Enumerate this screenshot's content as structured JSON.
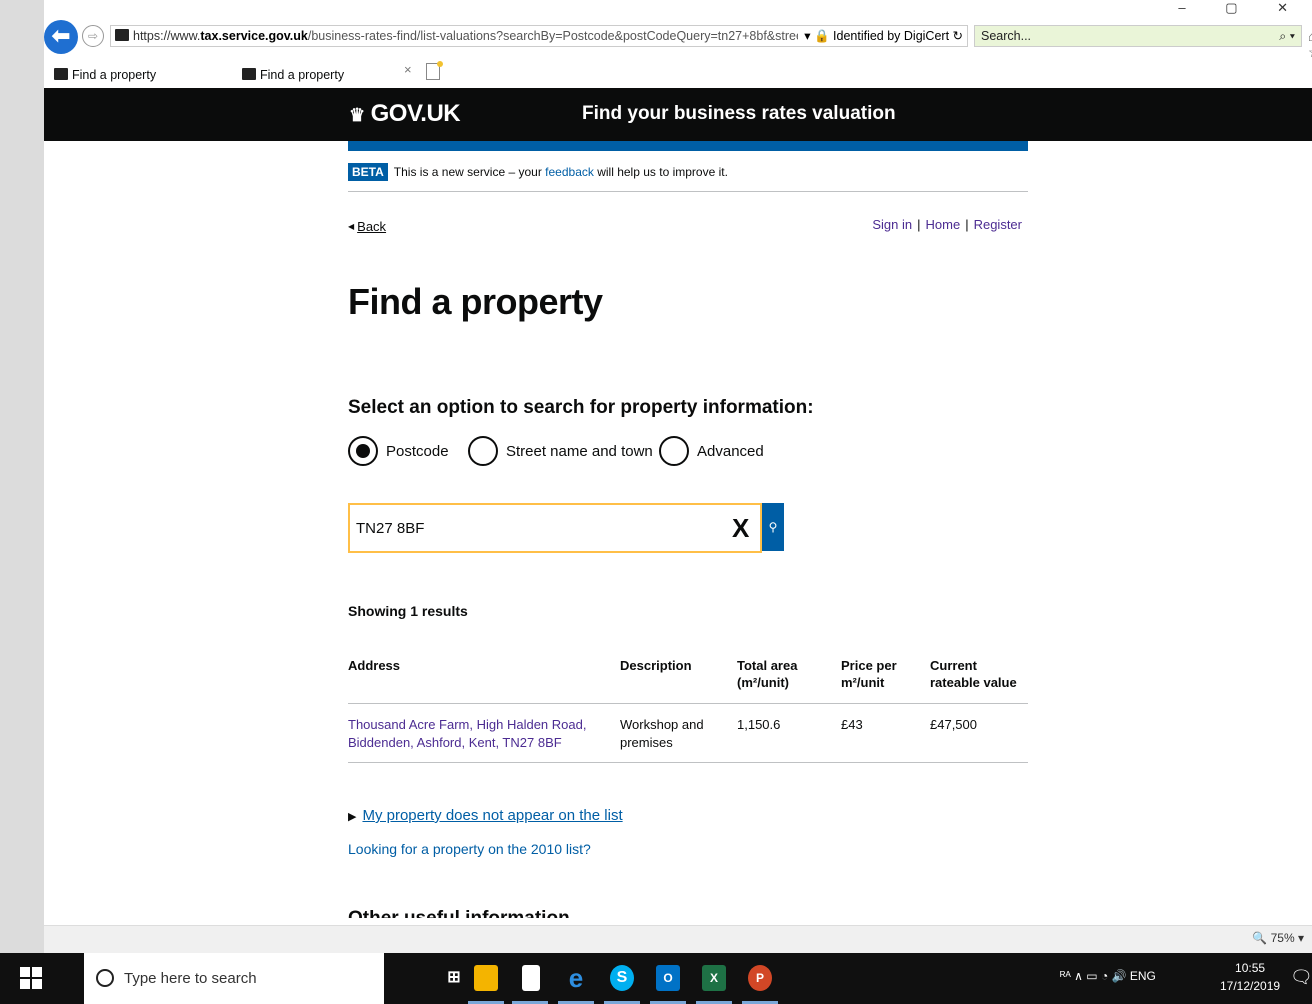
{
  "browser": {
    "back_icon": "back-arrow-icon",
    "url_prefix": "https://www.",
    "url_domain": "tax.service.gov.uk",
    "url_path": "/business-rates-find/list-valuations?searchBy=Postcode&postCodeQuery=tn27+8bf&streetQu",
    "cert": "▾ 🔒 Identified by DigiCert ↻",
    "search_placeholder": "Search...",
    "search_icon": "⌕ ▾",
    "right_icons": "⌂ ☆",
    "window_controls": "– ▢ ✕",
    "tabs": [
      {
        "label": "Find a property"
      },
      {
        "label": "Find a property"
      }
    ],
    "tab_close": "×"
  },
  "header": {
    "logo": "GOV.UK",
    "crown": "♛",
    "service_name": "Find your business rates valuation"
  },
  "beta": {
    "tag": "BETA",
    "text_before": "This is a new service – your ",
    "link": "feedback",
    "text_after": " will help us to improve it."
  },
  "nav": {
    "back": "Back",
    "sign_in": "Sign in",
    "home": "Home",
    "register": "Register",
    "sep": "|"
  },
  "page": {
    "title": "Find a property",
    "select_label": "Select an option to search for property information:",
    "radios": [
      {
        "label": "Postcode",
        "selected": true
      },
      {
        "label": "Street name and town",
        "selected": false
      },
      {
        "label": "Advanced",
        "selected": false
      }
    ],
    "search_value": "TN27 8BF",
    "clear_glyph": "X",
    "search_btn_glyph": "🔍",
    "showing": "Showing 1 results",
    "table": {
      "headers": [
        "Address",
        "Description",
        "Total area (m²/unit)",
        "Price per m²/unit",
        "Current rateable value"
      ],
      "rows": [
        [
          "Thousand Acre Farm, High Halden Road, Biddenden, Ashford, Kent, TN27 8BF",
          "Workshop and premises",
          "1,150.6",
          "£43",
          "£47,500"
        ]
      ]
    },
    "not_on_list": "My property does not appear on the list",
    "list_2010": "Looking for a property on the 2010 list?",
    "other_info": "Other useful information"
  },
  "statusbar": {
    "zoom": "🔍 75% ▾"
  },
  "taskbar": {
    "search_placeholder": "Type here to search",
    "tray": "ᴿᴬ ∧ ▭ ◔ 🔊 ENG",
    "time": "10:55",
    "date": "17/12/2019",
    "notif": "🗨"
  }
}
